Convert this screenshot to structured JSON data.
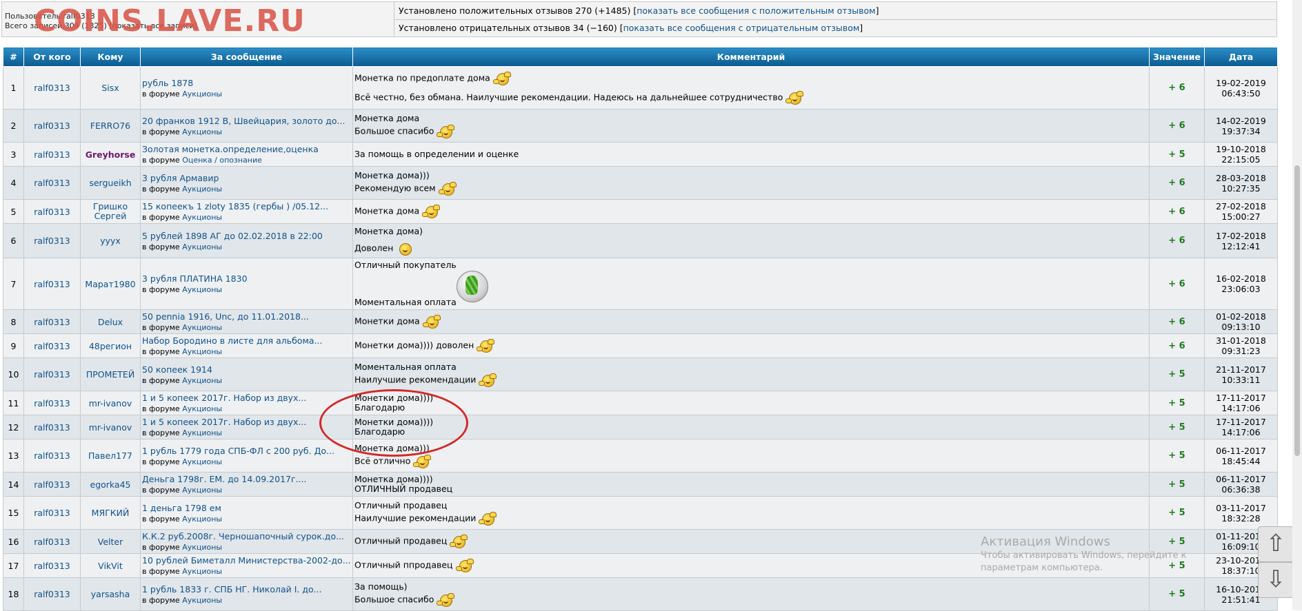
{
  "summary": {
    "user_label": "Пользователь ralf0313",
    "total_label": "Всего записей 304 (1325) [показать все записи]",
    "watermark": "COINS.LAVE.RU",
    "positive_text": "Установлено положительных отзывов 270 (+1485) [",
    "positive_link": "показать все сообщения с положительным отзывом",
    "negative_text": "Установлено отрицательных отзывов 34 (−160) [",
    "negative_link": "показать все сообщения с отрицательным отзывом",
    "close_bracket": "]"
  },
  "table": {
    "headers": [
      "#",
      "От кого",
      "Кому",
      "За сообщение",
      "Комментарий",
      "Значение",
      "Дата"
    ],
    "forum_prefix": "в форуме",
    "rows": [
      {
        "num": "1",
        "from": "ralf0313",
        "to": "Sisx",
        "title": "рубль 1878",
        "forum": "Аукционы",
        "comment": [
          "Монетка по предоплате дома",
          "Всё честно, без обмана. Наилучшие рекомендации. Надеюсь на дальнейшее сотрудничество"
        ],
        "value": "+ 6",
        "date": "19-02-2019",
        "time": "06:43:50"
      },
      {
        "num": "2",
        "from": "ralf0313",
        "to": "FERRO76",
        "title": "20 франков 1912 В, Швейцария, золото до...",
        "forum": "Аукционы",
        "comment": [
          "Монетка дома",
          "Большое спасибо"
        ],
        "value": "+ 6",
        "date": "14-02-2019",
        "time": "19:37:34"
      },
      {
        "num": "3",
        "from": "ralf0313",
        "to": "Greyhorse",
        "title": "Золотая монетка.определение,оценка",
        "forum": "Оценка / опознание",
        "comment": [
          "За помощь в определении и оценке"
        ],
        "value": "+ 5",
        "date": "19-10-2018",
        "time": "22:15:05"
      },
      {
        "num": "4",
        "from": "ralf0313",
        "to": "sergueikh",
        "title": "3 рубля Армавир",
        "forum": "Аукционы",
        "comment": [
          "Монетка дома)))",
          "Рекомендую всем"
        ],
        "value": "+ 6",
        "date": "28-03-2018",
        "time": "10:27:35"
      },
      {
        "num": "5",
        "from": "ralf0313",
        "to": "Гришко Сергей",
        "title": "15 копеекъ 1 zloty 1835 (гербы ) /05.12...",
        "forum": "Аукционы",
        "comment": [
          "Монетка дома"
        ],
        "value": "+ 6",
        "date": "27-02-2018",
        "time": "15:00:27"
      },
      {
        "num": "6",
        "from": "ralf0313",
        "to": "yyyx",
        "title": "5 рублей 1898 АГ до 02.02.2018 в 22:00",
        "forum": "Аукционы",
        "comment": [
          "Монетка дома)",
          "Доволен"
        ],
        "value": "+ 6",
        "date": "17-02-2018",
        "time": "12:12:41"
      },
      {
        "num": "7",
        "from": "ralf0313",
        "to": "Марат1980",
        "title": "3 рубля ПЛАТИНА 1830",
        "forum": "Аукционы",
        "comment": [
          "Отличный покупатель",
          "Моментальная оплата"
        ],
        "value": "+ 6",
        "date": "16-02-2018",
        "time": "23:06:03"
      },
      {
        "num": "8",
        "from": "ralf0313",
        "to": "Delux",
        "title": "50 pennia 1916, Unc, до 11.01.2018...",
        "forum": "Аукционы",
        "comment": [
          "Монетки дома"
        ],
        "value": "+ 6",
        "date": "01-02-2018",
        "time": "09:13:10"
      },
      {
        "num": "9",
        "from": "ralf0313",
        "to": "48регион",
        "title": "Набор Бородино в листе для альбома...",
        "forum": "Аукционы",
        "comment": [
          "Монетки дома)))) доволен"
        ],
        "value": "+ 6",
        "date": "31-01-2018",
        "time": "09:31:23"
      },
      {
        "num": "10",
        "from": "ralf0313",
        "to": "ПРОМЕТЕЙ",
        "title": "50 копеек 1914",
        "forum": "Аукционы",
        "comment": [
          "Моментальная оплата",
          "Наилучшие рекомендации"
        ],
        "value": "+ 5",
        "date": "21-11-2017",
        "time": "10:33:11"
      },
      {
        "num": "11",
        "from": "ralf0313",
        "to": "mr-ivanov",
        "title": "1 и 5 копеек 2017г. Набор из двух...",
        "forum": "Аукционы",
        "comment": [
          "Монетки дома))))",
          "Благодарю"
        ],
        "value": "+ 5",
        "date": "17-11-2017",
        "time": "14:17:06"
      },
      {
        "num": "12",
        "from": "ralf0313",
        "to": "mr-ivanov",
        "title": "1 и 5 копеек 2017г. Набор из двух...",
        "forum": "Аукционы",
        "comment": [
          "Монетки дома))))",
          "Благодарю"
        ],
        "value": "+ 5",
        "date": "17-11-2017",
        "time": "14:17:06"
      },
      {
        "num": "13",
        "from": "ralf0313",
        "to": "Павел177",
        "title": "1 рубль 1779 года СПБ-ФЛ с 200 руб. До...",
        "forum": "Аукционы",
        "comment": [
          "Монетка дома)))",
          "Всё отлично"
        ],
        "value": "+ 5",
        "date": "06-11-2017",
        "time": "18:45:44"
      },
      {
        "num": "14",
        "from": "ralf0313",
        "to": "egorka45",
        "title": "Деньга 1798г. ЕМ. до 14.09.2017г....",
        "forum": "Аукционы",
        "comment": [
          "Монетка дома))))",
          "ОТЛИЧНЫЙ продавец"
        ],
        "value": "+ 5",
        "date": "06-11-2017",
        "time": "06:36:38"
      },
      {
        "num": "15",
        "from": "ralf0313",
        "to": "МЯГКИЙ",
        "title": "1 деньга 1798 ем",
        "forum": "Аукционы",
        "comment": [
          "Отличный продавец",
          "Наилучшие рекомендации"
        ],
        "value": "+ 5",
        "date": "03-11-2017",
        "time": "18:32:28"
      },
      {
        "num": "16",
        "from": "ralf0313",
        "to": "Velter",
        "title": "К.К.2 руб.2008г. Черношапочный сурок.до...",
        "forum": "Аукционы",
        "comment": [
          "Отличный продавец"
        ],
        "value": "+ 5",
        "date": "01-11-2017",
        "time": "16:09:10"
      },
      {
        "num": "17",
        "from": "ralf0313",
        "to": "VikVit",
        "title": "10 рублей Биметалл Министерства-2002-до...",
        "forum": "Аукционы",
        "comment": [
          "Отличный ппродавец"
        ],
        "value": "+ 5",
        "date": "23-10-2017",
        "time": "18:37:10"
      },
      {
        "num": "18",
        "from": "ralf0313",
        "to": "yarsasha",
        "title": "1 рубль 1833 г. СПБ НГ. Николай I. до...",
        "forum": "Аукционы",
        "comment": [
          "За помощь)",
          "Большое спасибо"
        ],
        "value": "+ 5",
        "date": "16-10-2017",
        "time": "21:51:41"
      }
    ]
  },
  "windows": {
    "title": "Активация Windows",
    "subtitle": "Чтобы активировать Windows, перейдите к параметрам компьютера."
  },
  "nav": {
    "up_icon": "up-arrow-icon",
    "down_icon": "down-arrow-icon"
  },
  "colors": {
    "header_bg": "#1a73ad",
    "value_green": "#1e7a1e",
    "link": "#105289",
    "annotation": "#d12a2a"
  }
}
